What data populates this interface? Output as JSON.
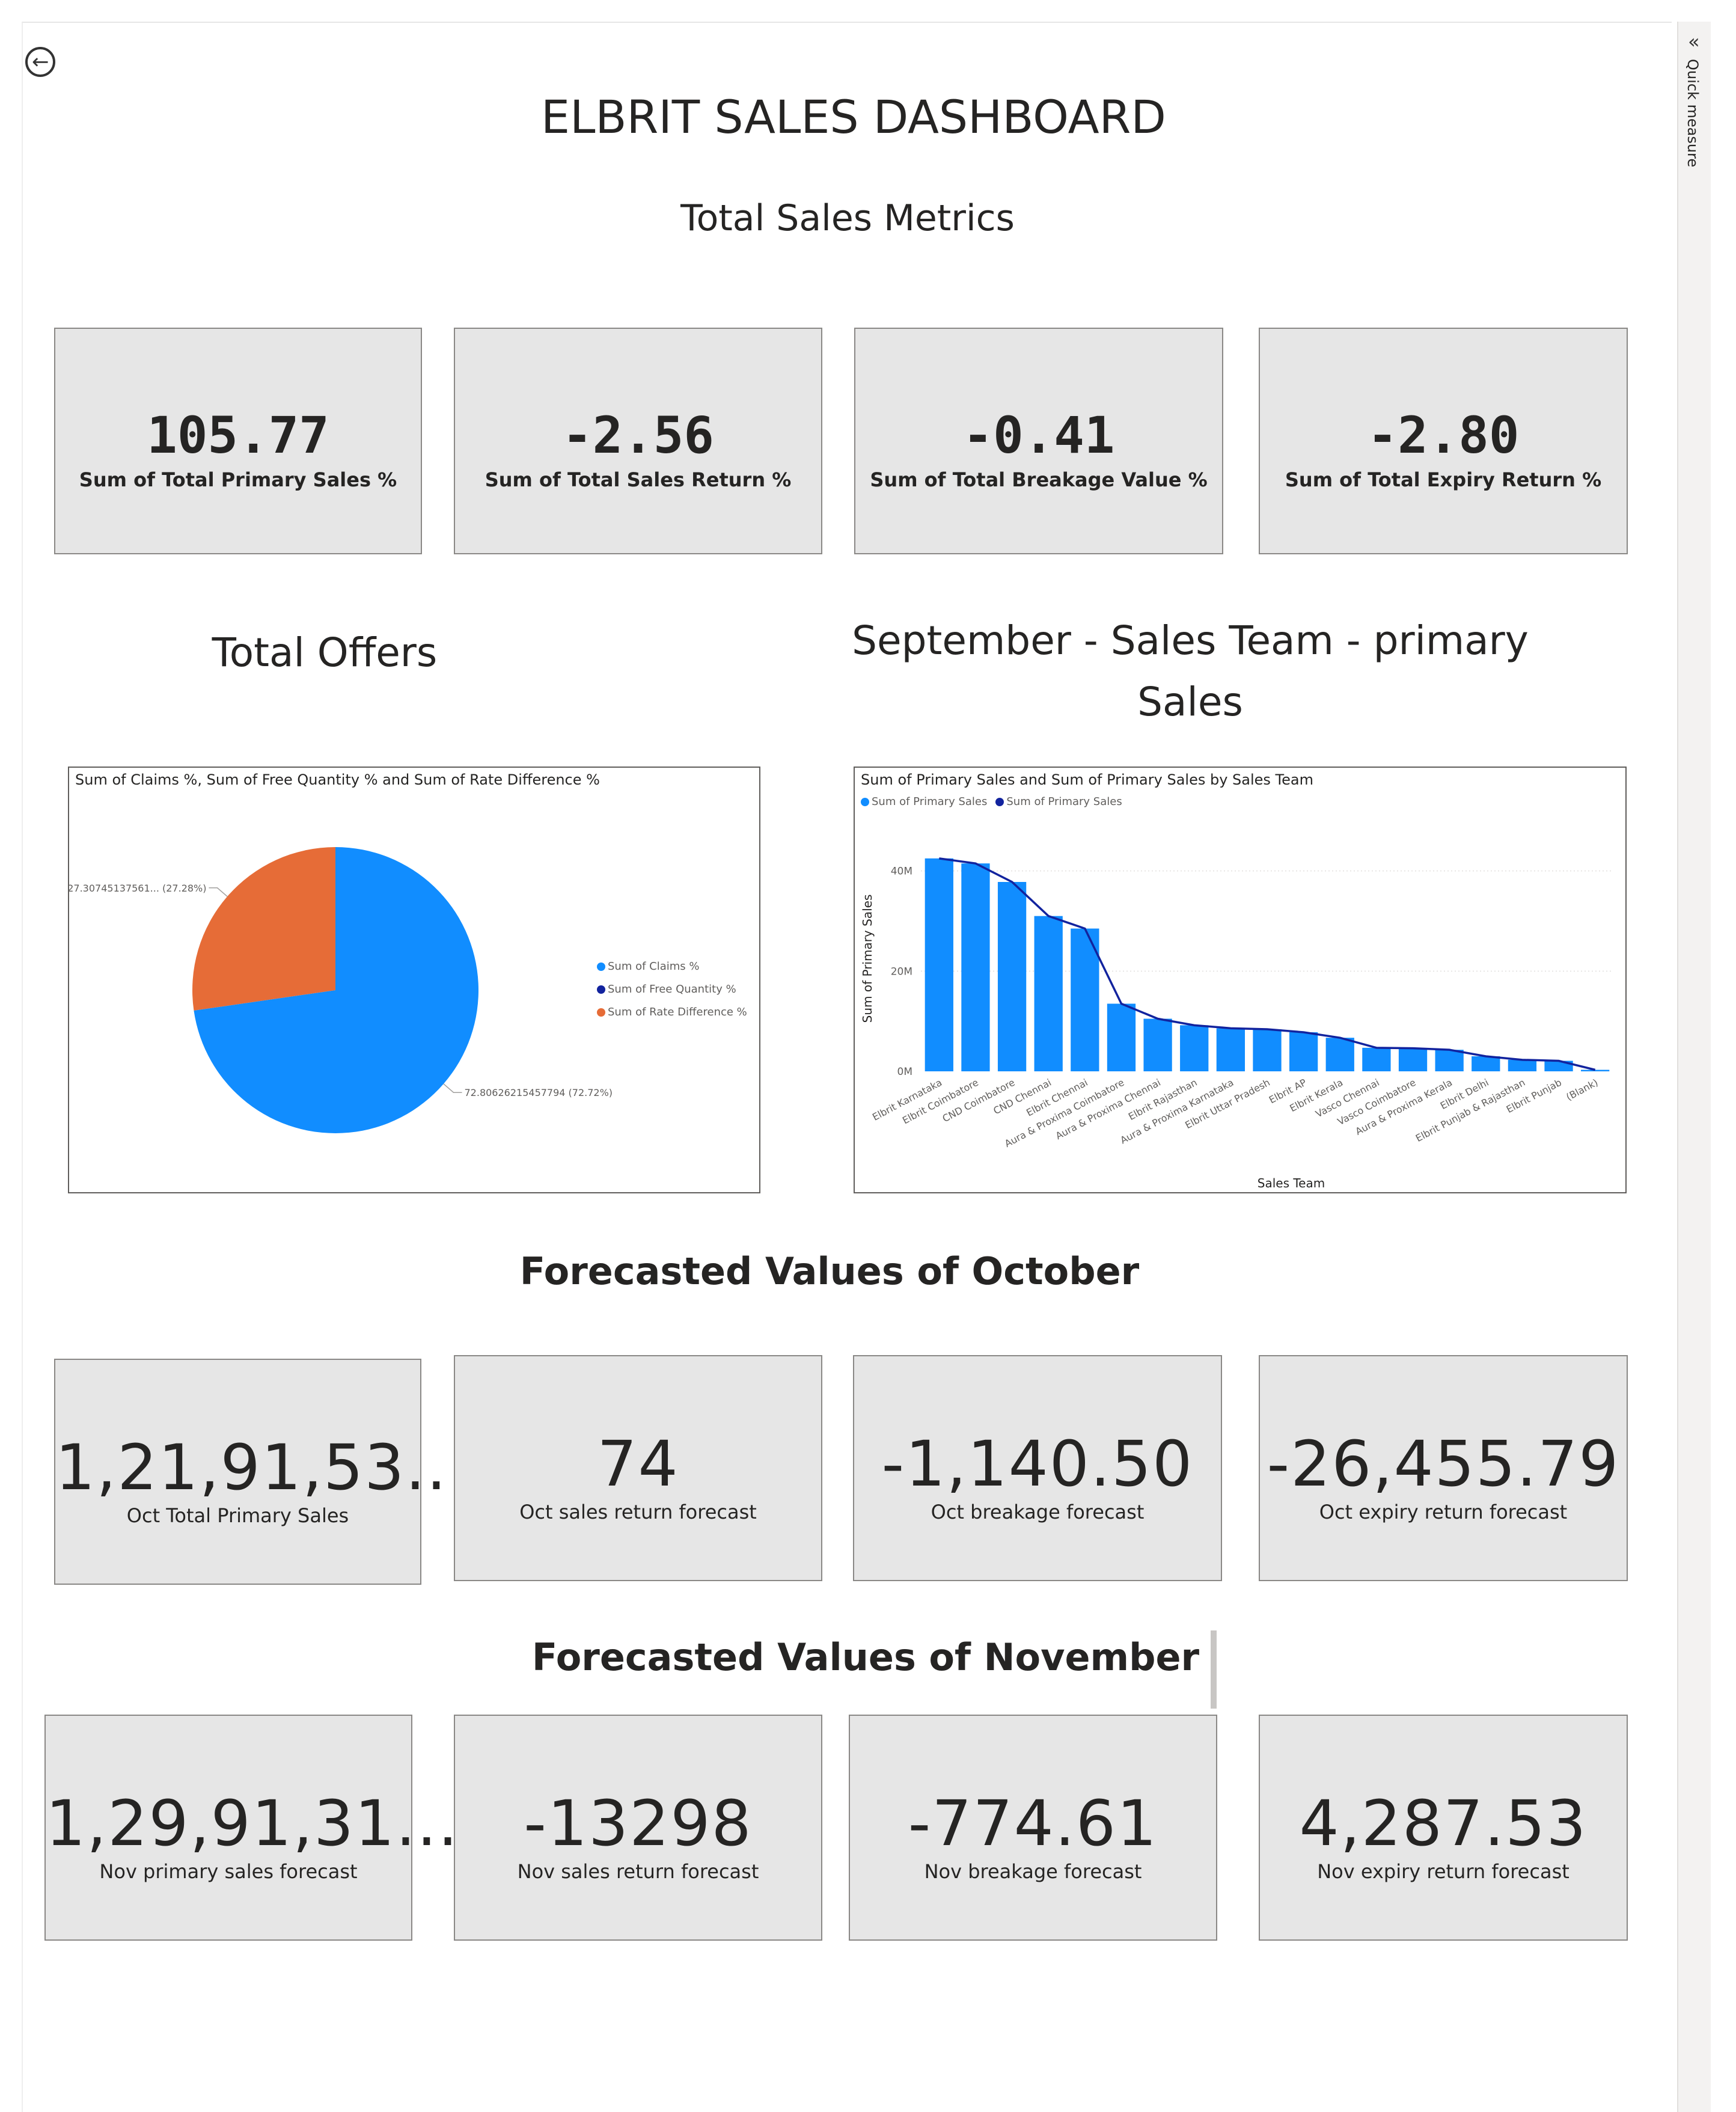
{
  "header": {
    "title": "ELBRIT SALES DASHBOARD",
    "back_icon": "back-arrow-icon"
  },
  "side_pane": {
    "label": "Quick measure",
    "collapse_icon": "double-chevron-left-icon"
  },
  "sections": {
    "metrics": "Total Sales Metrics",
    "offers": "Total Offers",
    "september": "September - Sales Team - primary Sales",
    "october": "Forecasted Values of October",
    "november": "Forecasted Values of November"
  },
  "metric_cards": [
    {
      "value": "105.77",
      "label": "Sum of Total Primary Sales %"
    },
    {
      "value": "-2.56",
      "label": "Sum of Total Sales Return %"
    },
    {
      "value": "-0.41",
      "label": "Sum of Total Breakage Value %"
    },
    {
      "value": "-2.80",
      "label": "Sum of Total Expiry Return %"
    }
  ],
  "october_cards": [
    {
      "value": "1,21,91,53...",
      "label": "Oct Total Primary Sales"
    },
    {
      "value": "74",
      "label": "Oct sales return forecast"
    },
    {
      "value": "-1,140.50",
      "label": "Oct breakage forecast"
    },
    {
      "value": "-26,455.79",
      "label": "Oct expiry return forecast"
    }
  ],
  "november_cards": [
    {
      "value": "1,29,91,31...",
      "label": "Nov primary sales forecast"
    },
    {
      "value": "-13298",
      "label": "Nov sales return forecast"
    },
    {
      "value": "-774.61",
      "label": "Nov breakage forecast"
    },
    {
      "value": "4,287.53",
      "label": "Nov expiry return forecast"
    }
  ],
  "colors": {
    "blue": "#118dff",
    "navy": "#12239e",
    "orange": "#e66c37"
  },
  "chart_data": [
    {
      "type": "pie",
      "title": "Sum of Claims %, Sum of Free Quantity % and Sum of Rate Difference %",
      "slices": [
        {
          "name": "Sum of Claims %",
          "value": 72.80626215457794,
          "label": "72.80626215457794 (72.72%)",
          "color": "#118dff"
        },
        {
          "name": "Sum of Free Quantity %",
          "value": 0,
          "color": "#12239e"
        },
        {
          "name": "Sum of Rate Difference %",
          "value": 27.30745137561,
          "label": "27.30745137561... (27.28%)",
          "color": "#e66c37"
        }
      ],
      "legend_position": "right"
    },
    {
      "type": "bar",
      "title": "Sum of Primary Sales and Sum of Primary Sales by Sales Team",
      "xlabel": "Sales Team",
      "ylabel": "Sum of Primary Sales",
      "ylim": [
        0,
        45000000
      ],
      "yticks": [
        {
          "value": 0,
          "label": "0M"
        },
        {
          "value": 20000000,
          "label": "20M"
        },
        {
          "value": 40000000,
          "label": "40M"
        }
      ],
      "grid": true,
      "legend_position": "top-left",
      "categories": [
        "Elbrit Karnataka",
        "Elbrit Coimbatore",
        "CND Coimbatore",
        "CND Chennai",
        "Elbrit Chennai",
        "Aura & Proxima Coimbatore",
        "Aura & Proxima Chennai",
        "Elbrit Rajasthan",
        "Aura & Proxima Karnataka",
        "Elbrit Uttar Pradesh",
        "Elbrit AP",
        "Elbrit Kerala",
        "Vasco Chennai",
        "Vasco Coimbatore",
        "Aura & Proxima Kerala",
        "Elbrit Delhi",
        "Elbrit Punjab & Rajasthan",
        "Elbrit Punjab",
        "(Blank)"
      ],
      "series": [
        {
          "name": "Sum of Primary Sales",
          "kind": "bar",
          "color": "#118dff",
          "values": [
            42500000,
            41500000,
            37800000,
            31000000,
            28500000,
            13500000,
            10500000,
            9200000,
            8600000,
            8400000,
            7800000,
            6700000,
            4700000,
            4600000,
            4300000,
            3000000,
            2300000,
            2100000,
            300000
          ]
        },
        {
          "name": "Sum of Primary Sales",
          "kind": "line",
          "color": "#12239e",
          "values": [
            42500000,
            41500000,
            37800000,
            31000000,
            28500000,
            13500000,
            10500000,
            9200000,
            8600000,
            8400000,
            7800000,
            6700000,
            4700000,
            4600000,
            4300000,
            3000000,
            2300000,
            2100000,
            300000
          ]
        }
      ]
    }
  ]
}
